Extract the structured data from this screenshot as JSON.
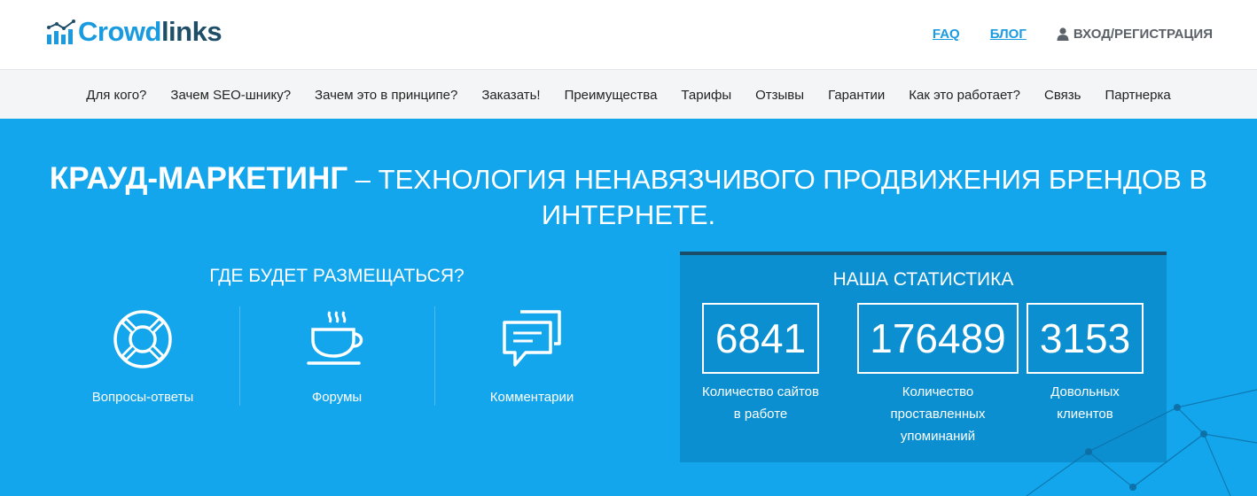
{
  "brand": {
    "name_part1": "Crowd",
    "name_part2": "links",
    "icon": "bar-chart-logo-icon",
    "color_primary": "#1a9be0",
    "color_dark": "#1f4e69"
  },
  "top_links": {
    "faq": "FAQ",
    "blog": "БЛОГ",
    "login": "ВХОД/РЕГИСТРАЦИЯ",
    "login_icon": "user-icon"
  },
  "nav": {
    "items": [
      "Для кого?",
      "Зачем SEO-шнику?",
      "Зачем это в принципе?",
      "Заказать!",
      "Преимущества",
      "Тарифы",
      "Отзывы",
      "Гарантии",
      "Как это работает?",
      "Связь",
      "Партнерка"
    ]
  },
  "hero": {
    "title_bold": "КРАУД-МАРКЕТИНГ",
    "title_rest": " – ТЕХНОЛОГИЯ НЕНАВЯЗЧИВОГО ПРОДВИЖЕНИЯ БРЕНДОВ В ИНТЕРНЕТЕ.",
    "background_color": "#13a6ec"
  },
  "places": {
    "title": "ГДЕ БУДЕТ РАЗМЕЩАТЬСЯ?",
    "items": [
      {
        "label": "Вопросы-ответы",
        "icon": "lifebuoy-icon"
      },
      {
        "label": "Форумы",
        "icon": "coffee-cup-icon"
      },
      {
        "label": "Комментарии",
        "icon": "chat-bubbles-icon"
      }
    ]
  },
  "stats": {
    "title": "НАША СТАТИСТИКА",
    "items": [
      {
        "value": "6841",
        "label_line1": "Количество сайтов",
        "label_line2": "в работе",
        "label_line3": ""
      },
      {
        "value": "176489",
        "label_line1": "Количество",
        "label_line2": "проставленных",
        "label_line3": "упоминаний"
      },
      {
        "value": "3153",
        "label_line1": "Довольных",
        "label_line2": "клиентов",
        "label_line3": ""
      }
    ],
    "background_color": "#0b8fd0"
  }
}
